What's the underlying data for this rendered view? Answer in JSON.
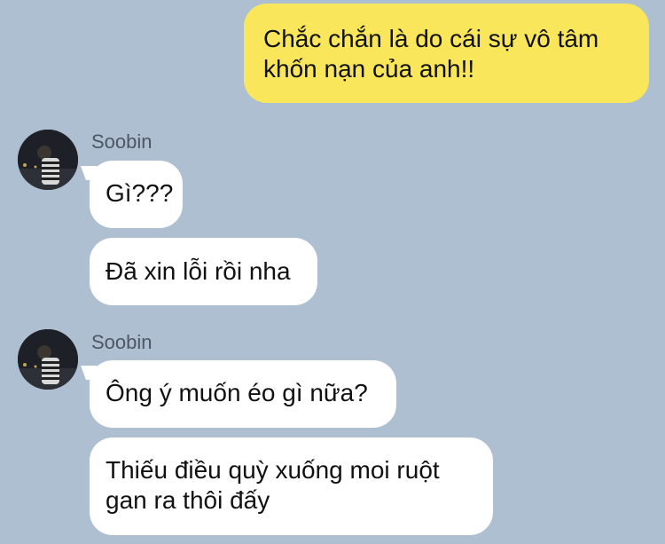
{
  "conversation": {
    "outgoing": [
      {
        "text": "Chắc chắn là do cái sự vô tâm\nkhốn nạn của anh!!"
      }
    ],
    "groups": [
      {
        "sender": "Soobin",
        "messages": [
          "Gì???",
          "Đã xin lỗi rồi nha"
        ]
      },
      {
        "sender": "Soobin",
        "messages": [
          "Ông ý muốn éo gì nữa?",
          "Thiếu điều quỳ xuống moi ruột\ngan ra thôi đấy"
        ]
      }
    ]
  },
  "colors": {
    "background": "#aebfd1",
    "incoming_bubble": "#ffffff",
    "outgoing_bubble": "#f9e65a",
    "sender_name": "#4d5763"
  },
  "icons": {
    "avatar": "user-avatar-photo"
  }
}
